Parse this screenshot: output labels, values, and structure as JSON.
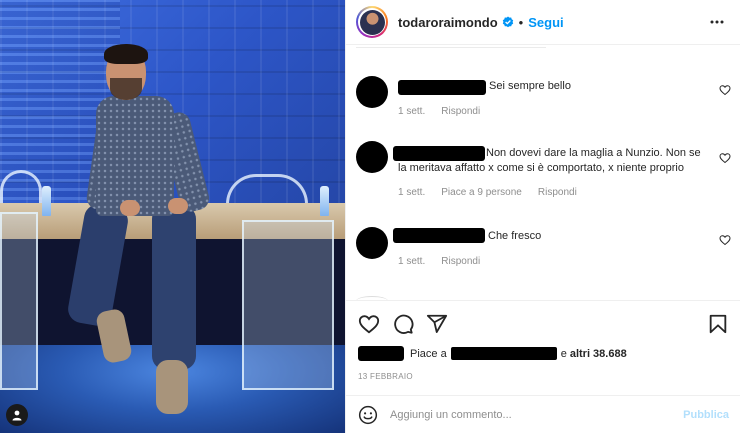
{
  "post": {
    "username": "todaroraimondo",
    "follow_label": "Segui",
    "separator": "•"
  },
  "comments": [
    {
      "text": "Sei sempre bello",
      "time": "1 sett.",
      "reply": "Rispondi",
      "likes": ""
    },
    {
      "text": "Non dovevi dare la maglia a Nunzio. Non se",
      "text2": "la meritava affatto x come si è comportato, x niente proprio",
      "time": "1 sett.",
      "likes": "Piace a 9 persone",
      "reply": "Rispondi"
    },
    {
      "text": "Che fresco",
      "time": "1 sett.",
      "reply": "Rispondi",
      "likes": ""
    }
  ],
  "likes": {
    "prefix": "Piace a",
    "connector": "e",
    "others": "altri 38.688"
  },
  "date": "13 FEBBRAIO",
  "add_comment": {
    "placeholder": "Aggiungi un commento...",
    "publish_label": "Pubblica"
  },
  "icons": [
    "user-tag-icon",
    "verified-badge-icon",
    "more-options-icon",
    "heart-icon",
    "comment-icon",
    "share-icon",
    "bookmark-icon",
    "emoji-icon"
  ],
  "colors": {
    "accent": "#0095f6",
    "publish_disabled": "#b2dffc",
    "muted": "#8e8e8e"
  }
}
